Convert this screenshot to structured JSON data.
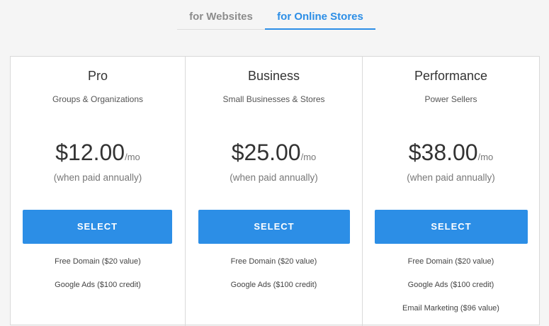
{
  "tabs": {
    "websites": "for Websites",
    "stores": "for Online Stores"
  },
  "plans": [
    {
      "name": "Pro",
      "description": "Groups & Organizations",
      "price": "$12.00",
      "per": "/mo",
      "billing": "(when paid annually)",
      "button": "SELECT",
      "features": [
        "Free Domain ($20 value)",
        "Google Ads ($100 credit)"
      ]
    },
    {
      "name": "Business",
      "description": "Small Businesses & Stores",
      "price": "$25.00",
      "per": "/mo",
      "billing": "(when paid annually)",
      "button": "SELECT",
      "features": [
        "Free Domain ($20 value)",
        "Google Ads ($100 credit)"
      ]
    },
    {
      "name": "Performance",
      "description": "Power Sellers",
      "price": "$38.00",
      "per": "/mo",
      "billing": "(when paid annually)",
      "button": "SELECT",
      "features": [
        "Free Domain ($20 value)",
        "Google Ads ($100 credit)",
        "Email Marketing ($96 value)"
      ]
    }
  ],
  "colors": {
    "accent": "#2c8ee6",
    "inactive_tab": "#8c8c8c",
    "page_background": "#f5f5f5"
  }
}
